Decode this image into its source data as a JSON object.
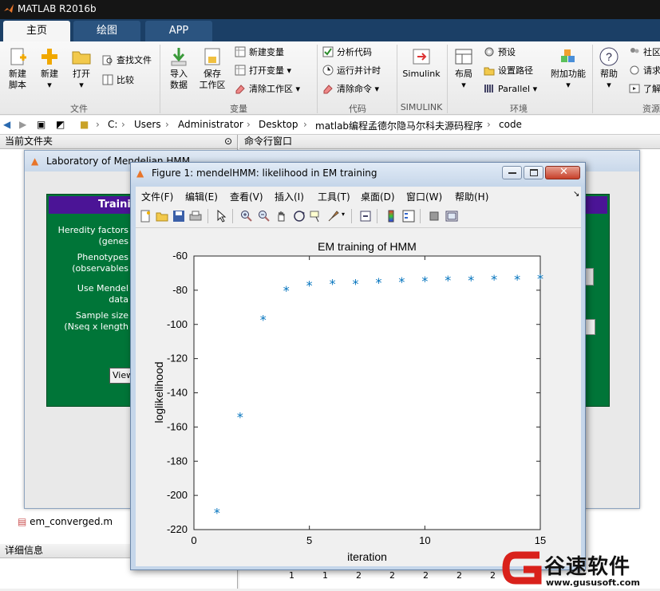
{
  "app": {
    "title": "MATLAB R2016b"
  },
  "tabs": [
    {
      "label": "主页"
    },
    {
      "label": "绘图"
    },
    {
      "label": "APP"
    }
  ],
  "ribbon": {
    "file": {
      "new_script": "新建\n脚本",
      "new": "新建",
      "open": "打开",
      "find_files": "查找文件",
      "compare": "比较",
      "group": "文件"
    },
    "variable": {
      "import": "导入\n数据",
      "save_ws": "保存\n工作区",
      "new_var": "新建变量",
      "open_var": "打开变量",
      "clear_ws": "清除工作区",
      "group": "变量"
    },
    "code": {
      "analyze": "分析代码",
      "run_time": "运行并计时",
      "clear_cmd": "清除命令",
      "group": "代码"
    },
    "simulink": {
      "label": "Simulink",
      "group": "SIMULINK"
    },
    "env": {
      "layout": "布局",
      "prefs": "预设",
      "set_path": "设置路径",
      "parallel": "Parallel",
      "addons": "附加功能",
      "group": "环境"
    },
    "resources": {
      "help": "帮助",
      "community": "社区",
      "request": "请求",
      "learn": "了解",
      "group": "资源"
    }
  },
  "address": {
    "crumbs": [
      "C:",
      "Users",
      "Administrator",
      "Desktop",
      "matlab编程孟德尔隐马尔科夫源码程序",
      "code"
    ]
  },
  "left_pane": {
    "header": "当前文件夹",
    "file": "em_converged.m",
    "details": "详细信息"
  },
  "right_pane": {
    "header": "命令行窗口",
    "bottom_numbers": [
      "1",
      "1",
      "2",
      "2",
      "2",
      "2",
      "2"
    ]
  },
  "lab_window": {
    "title": "Laboratory of Mendelian HMM",
    "panel_title": "Traini",
    "heredity": "Heredity factors\n(genes",
    "phenotypes": "Phenotypes\n(observables",
    "use_mendel": "Use Mendel data",
    "sample_size": "Sample size\n(Nseq x length",
    "view_btn": "View"
  },
  "figure": {
    "title": "Figure 1: mendelHMM: likelihood in EM training",
    "menu": [
      "文件(F)",
      "编辑(E)",
      "查看(V)",
      "插入(I)",
      "工具(T)",
      "桌面(D)",
      "窗口(W)",
      "帮助(H)"
    ]
  },
  "chart_data": {
    "type": "scatter",
    "title": "EM training of HMM",
    "xlabel": "iteration",
    "ylabel": "loglikelihood",
    "xlim": [
      0,
      15
    ],
    "ylim": [
      -220,
      -60
    ],
    "xticks": [
      0,
      5,
      10,
      15
    ],
    "yticks": [
      -220,
      -200,
      -180,
      -160,
      -140,
      -120,
      -100,
      -80,
      -60
    ],
    "marker": "*",
    "color": "#0072bd",
    "grid": false,
    "x": [
      1,
      2,
      3,
      4,
      5,
      6,
      7,
      8,
      9,
      10,
      11,
      12,
      13,
      14,
      15
    ],
    "y": [
      -210,
      -154,
      -97,
      -80,
      -77,
      -76,
      -76,
      -75.5,
      -75,
      -74.5,
      -74,
      -74,
      -73.5,
      -73.5,
      -73
    ]
  },
  "watermark": {
    "brand": "谷速软件",
    "url": "www.gususoft.com",
    "color": "#d9211b"
  }
}
